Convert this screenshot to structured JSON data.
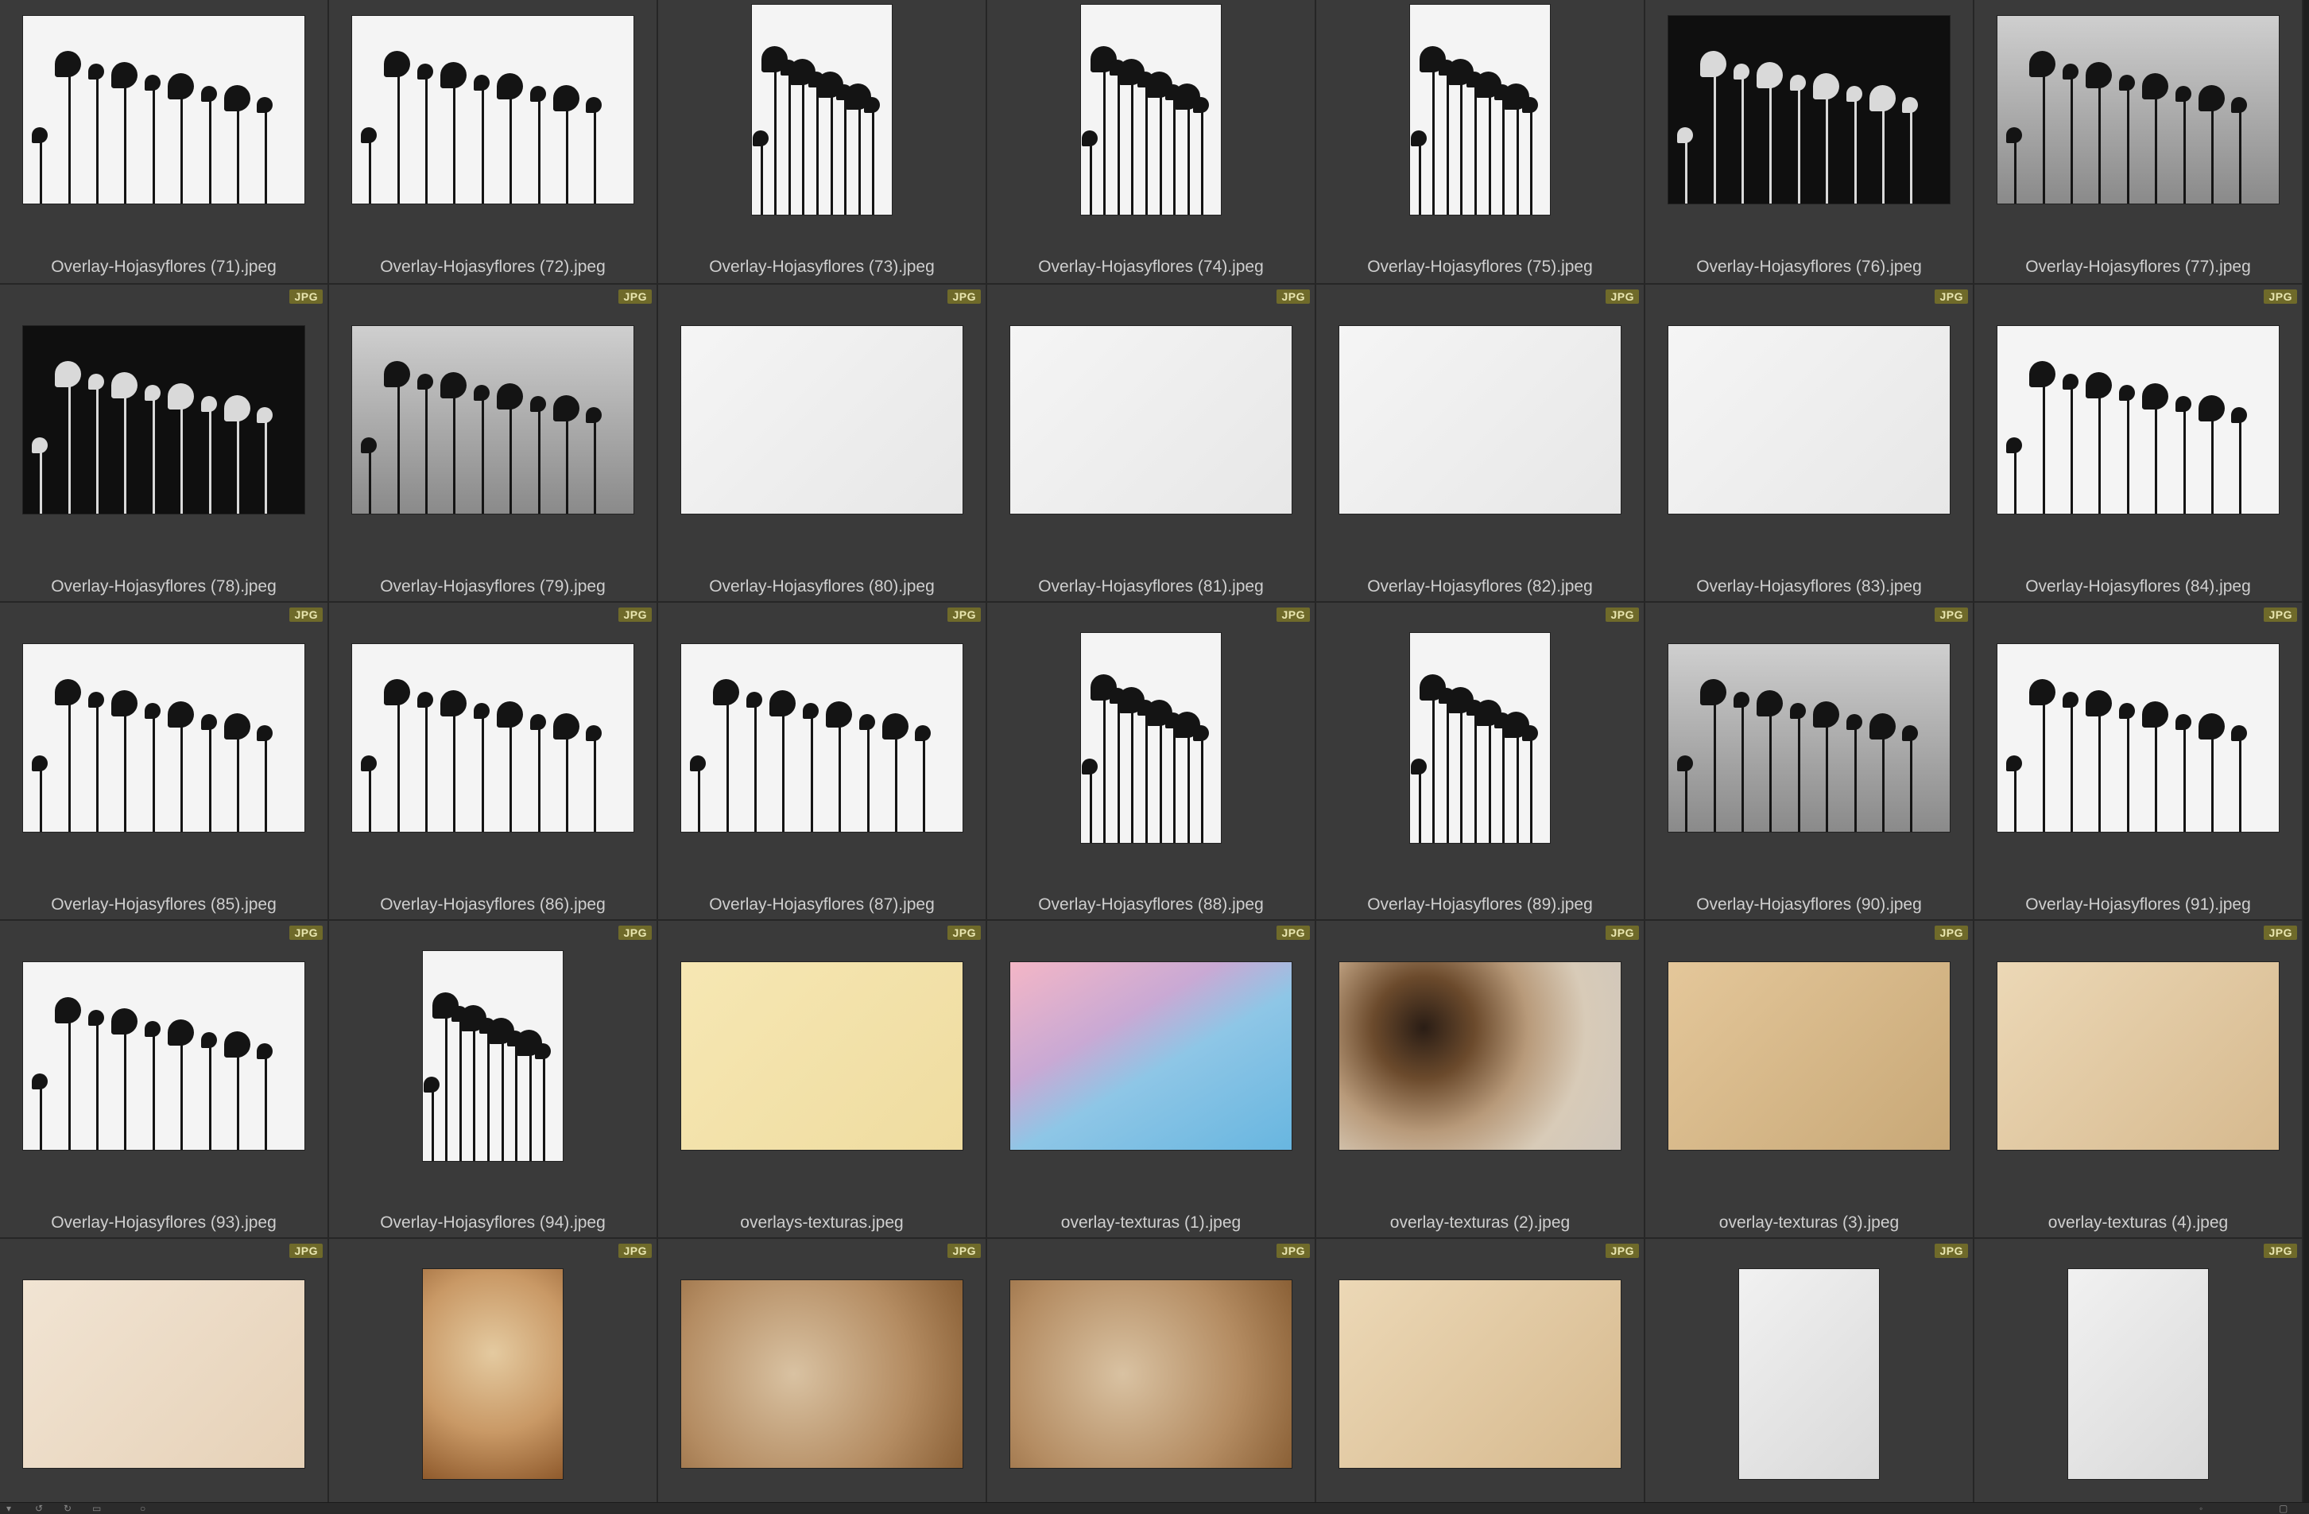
{
  "badge_label": "JPG",
  "items": [
    {
      "name": "Overlay-Hojasyflores (71).jpeg",
      "style": "t-silhouette",
      "orient": "land",
      "badge": false
    },
    {
      "name": "Overlay-Hojasyflores (72).jpeg",
      "style": "t-silhouette",
      "orient": "land",
      "badge": false
    },
    {
      "name": "Overlay-Hojasyflores (73).jpeg",
      "style": "t-silhouette",
      "orient": "port",
      "badge": false
    },
    {
      "name": "Overlay-Hojasyflores (74).jpeg",
      "style": "t-silhouette",
      "orient": "port",
      "badge": false
    },
    {
      "name": "Overlay-Hojasyflores (75).jpeg",
      "style": "t-silhouette",
      "orient": "port",
      "badge": false
    },
    {
      "name": "Overlay-Hojasyflores (76).jpeg",
      "style": "t-dark",
      "orient": "land",
      "badge": false
    },
    {
      "name": "Overlay-Hojasyflores (77).jpeg",
      "style": "t-grey",
      "orient": "land",
      "badge": false
    },
    {
      "name": "Overlay-Hojasyflores (78).jpeg",
      "style": "t-dark",
      "orient": "land",
      "badge": true
    },
    {
      "name": "Overlay-Hojasyflores (79).jpeg",
      "style": "t-grey",
      "orient": "land",
      "badge": true
    },
    {
      "name": "Overlay-Hojasyflores (80).jpeg",
      "style": "t-shadow",
      "orient": "land",
      "badge": true
    },
    {
      "name": "Overlay-Hojasyflores (81).jpeg",
      "style": "t-shadow",
      "orient": "land",
      "badge": true
    },
    {
      "name": "Overlay-Hojasyflores (82).jpeg",
      "style": "t-shadow",
      "orient": "land",
      "badge": true
    },
    {
      "name": "Overlay-Hojasyflores (83).jpeg",
      "style": "t-shadow",
      "orient": "land",
      "badge": true
    },
    {
      "name": "Overlay-Hojasyflores (84).jpeg",
      "style": "t-silhouette",
      "orient": "land",
      "badge": true
    },
    {
      "name": "Overlay-Hojasyflores (85).jpeg",
      "style": "t-silhouette",
      "orient": "land",
      "badge": true
    },
    {
      "name": "Overlay-Hojasyflores (86).jpeg",
      "style": "t-silhouette",
      "orient": "land",
      "badge": true
    },
    {
      "name": "Overlay-Hojasyflores (87).jpeg",
      "style": "t-silhouette",
      "orient": "land",
      "badge": true
    },
    {
      "name": "Overlay-Hojasyflores (88).jpeg",
      "style": "t-silhouette",
      "orient": "port",
      "badge": true
    },
    {
      "name": "Overlay-Hojasyflores (89).jpeg",
      "style": "t-silhouette",
      "orient": "port",
      "badge": true
    },
    {
      "name": "Overlay-Hojasyflores (90).jpeg",
      "style": "t-grey",
      "orient": "land",
      "badge": true
    },
    {
      "name": "Overlay-Hojasyflores (91).jpeg",
      "style": "t-silhouette",
      "orient": "land",
      "badge": true
    },
    {
      "name": "Overlay-Hojasyflores (93).jpeg",
      "style": "t-silhouette",
      "orient": "land",
      "badge": true
    },
    {
      "name": "Overlay-Hojasyflores (94).jpeg",
      "style": "t-silhouette",
      "orient": "port",
      "badge": true
    },
    {
      "name": "overlays-texturas.jpeg",
      "style": "t-cream",
      "orient": "land",
      "badge": true
    },
    {
      "name": "overlay-texturas (1).jpeg",
      "style": "t-pastel",
      "orient": "land",
      "badge": true
    },
    {
      "name": "overlay-texturas (2).jpeg",
      "style": "t-burnt",
      "orient": "land",
      "badge": true
    },
    {
      "name": "overlay-texturas (3).jpeg",
      "style": "t-beige",
      "orient": "land",
      "badge": true
    },
    {
      "name": "overlay-texturas (4).jpeg",
      "style": "t-beige2",
      "orient": "land",
      "badge": true
    },
    {
      "name": "",
      "style": "t-ivory",
      "orient": "land",
      "badge": true
    },
    {
      "name": "",
      "style": "t-kraft",
      "orient": "port",
      "badge": true
    },
    {
      "name": "",
      "style": "t-stone",
      "orient": "land",
      "badge": true
    },
    {
      "name": "",
      "style": "t-stone",
      "orient": "land",
      "badge": true
    },
    {
      "name": "",
      "style": "t-beige2",
      "orient": "land",
      "badge": true
    },
    {
      "name": "",
      "style": "t-paper",
      "orient": "port",
      "badge": true
    },
    {
      "name": "",
      "style": "t-paper",
      "orient": "port",
      "badge": true
    }
  ]
}
